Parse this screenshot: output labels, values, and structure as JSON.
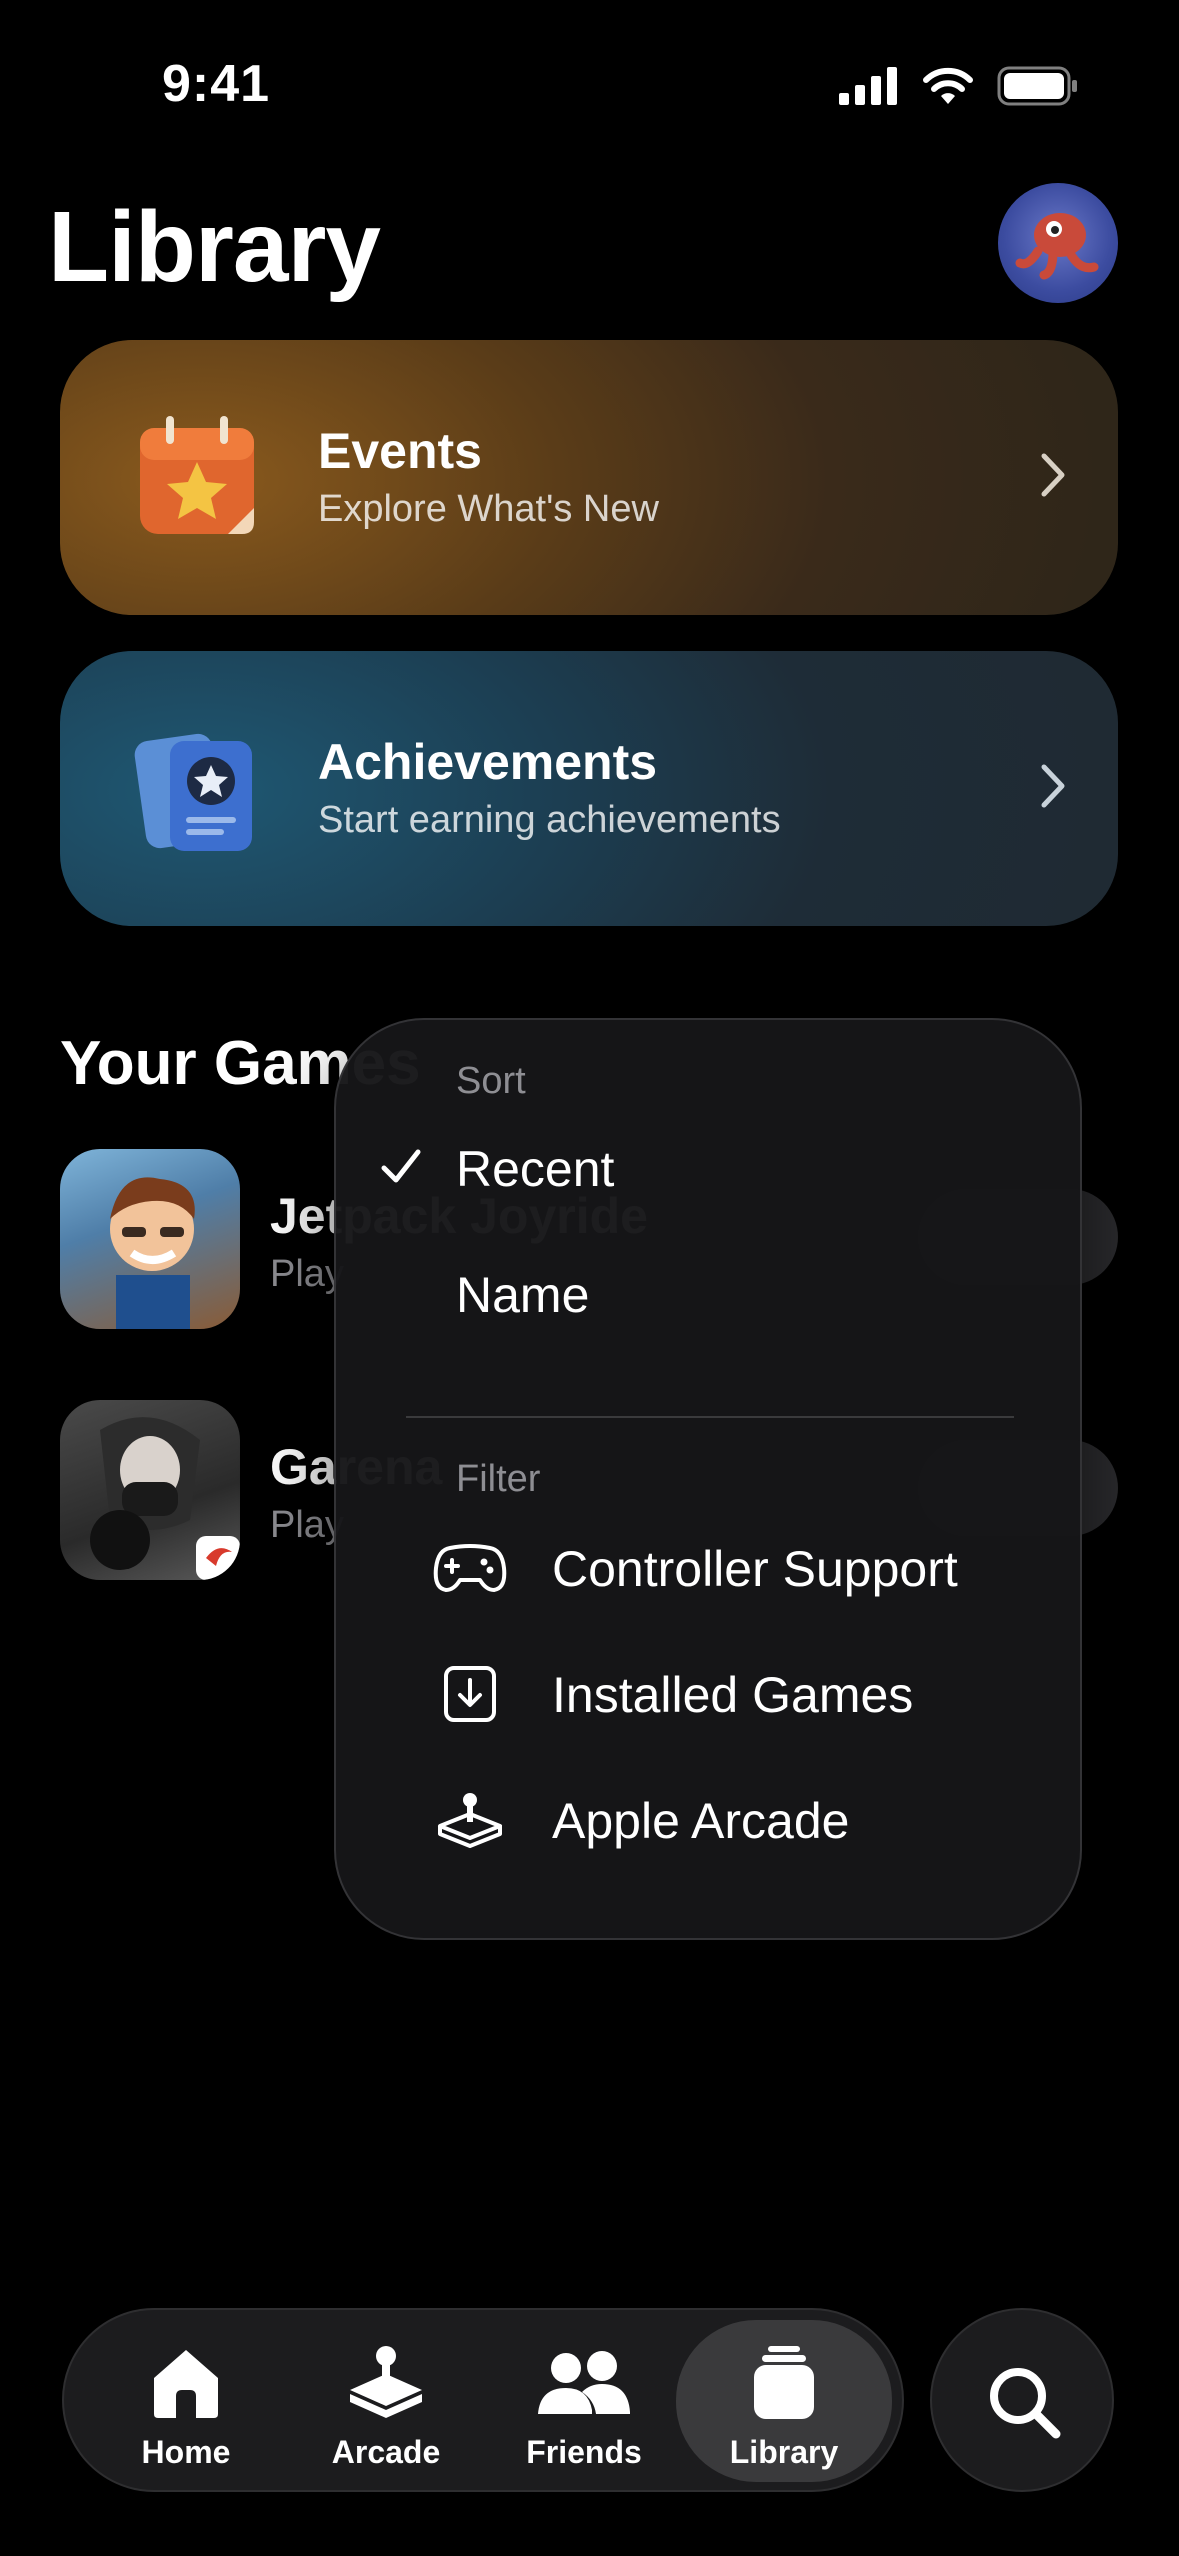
{
  "status_bar": {
    "time": "9:41"
  },
  "header": {
    "title": "Library"
  },
  "cards": [
    {
      "title": "Events",
      "subtitle": "Explore What's New"
    },
    {
      "title": "Achievements",
      "subtitle": "Start earning achievements"
    }
  ],
  "games": {
    "section_title": "Your Games",
    "items": [
      {
        "name": "Jetpack Joyride",
        "subtitle": "Play"
      },
      {
        "name": "Garena",
        "subtitle": "Play"
      }
    ]
  },
  "menu": {
    "sort_header": "Sort",
    "sort_options": [
      {
        "label": "Recent",
        "selected": true
      },
      {
        "label": "Name",
        "selected": false
      }
    ],
    "filter_header": "Filter",
    "filter_options": [
      {
        "label": "Controller Support",
        "icon": "gamecontroller-icon"
      },
      {
        "label": "Installed Games",
        "icon": "download-box-icon"
      },
      {
        "label": "Apple Arcade",
        "icon": "arcade-joystick-icon"
      }
    ]
  },
  "tab_bar": {
    "tabs": [
      {
        "label": "Home",
        "icon": "house-icon",
        "active": false
      },
      {
        "label": "Arcade",
        "icon": "arcade-joystick-icon",
        "active": false
      },
      {
        "label": "Friends",
        "icon": "people-icon",
        "active": false
      },
      {
        "label": "Library",
        "icon": "stack-icon",
        "active": true
      }
    ],
    "search_icon": "search-icon"
  },
  "colors": {
    "background": "#000000",
    "events_card": "#5a3c18",
    "achievements_card": "#1c3e52",
    "menu_bg": "#161618",
    "tab_active": "#3a3a3c"
  }
}
